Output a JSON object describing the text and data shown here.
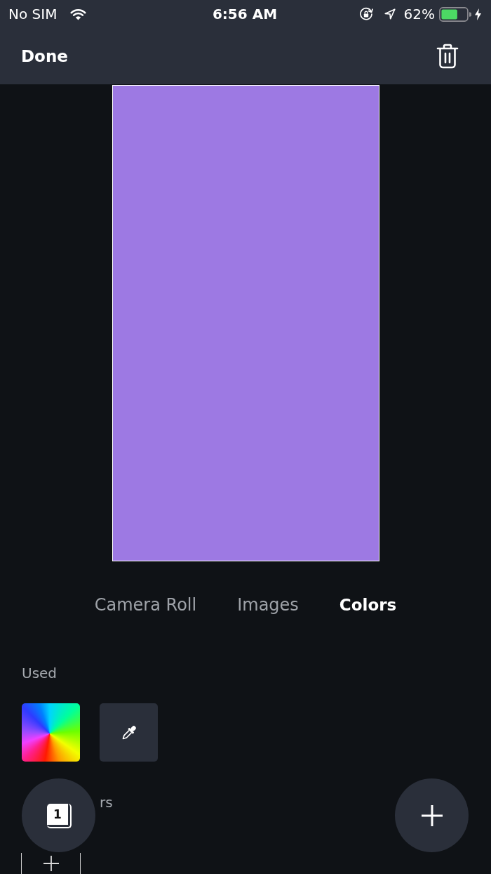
{
  "status_bar": {
    "carrier": "No SIM",
    "time": "6:56 AM",
    "battery_percent": "62%",
    "charging": true
  },
  "nav_bar": {
    "done_label": "Done"
  },
  "tabs": [
    {
      "label": "Camera Roll",
      "selected": false
    },
    {
      "label": "Images",
      "selected": false
    },
    {
      "label": "Colors",
      "selected": true
    }
  ],
  "colors_panel": {
    "used_label": "Used",
    "used_tiles": [
      {
        "kind": "color-wheel"
      },
      {
        "kind": "eyedropper"
      }
    ],
    "section_label_tail": "rs"
  },
  "page_button": {
    "count": "1"
  }
}
